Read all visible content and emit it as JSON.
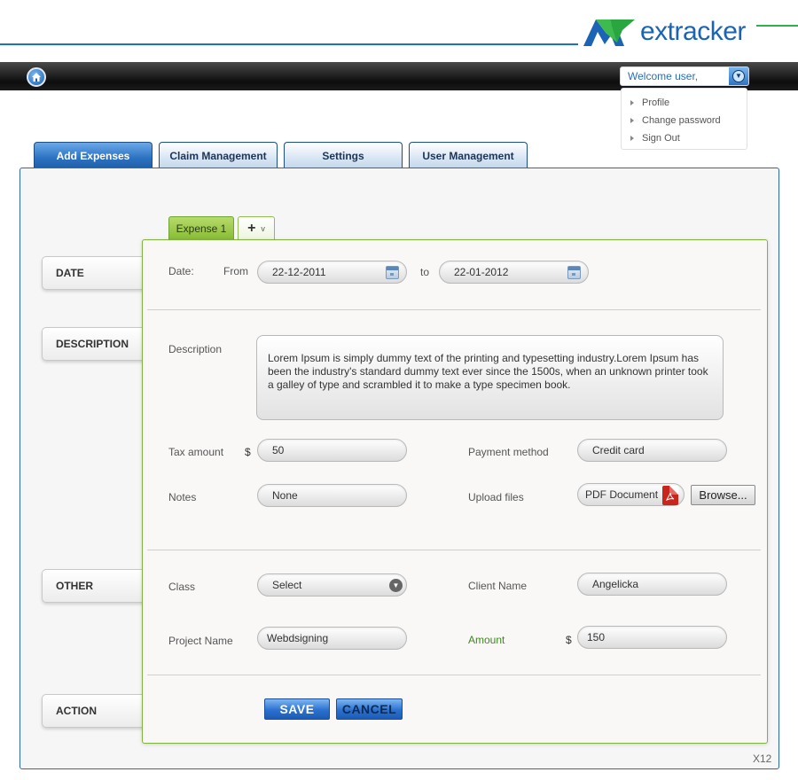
{
  "header": {
    "logo_text": "extracker",
    "welcome_label": "Welcome user,",
    "user_menu": [
      {
        "label": "Profile"
      },
      {
        "label": "Change password"
      },
      {
        "label": "Sign Out"
      }
    ]
  },
  "tabs": [
    {
      "label": "Add Expenses",
      "active": true
    },
    {
      "label": "Claim Management",
      "active": false
    },
    {
      "label": "Settings",
      "active": false
    },
    {
      "label": "User Management",
      "active": false
    }
  ],
  "sections": {
    "date": "DATE",
    "description": "DESCRIPTION",
    "other": "OTHER",
    "action": "ACTION"
  },
  "expense_tabs": {
    "current": "Expense 1",
    "add_symbol": "+",
    "add_caret": "v"
  },
  "form": {
    "date_label": "Date:",
    "from_label": "From",
    "from_value": "22-12-2011",
    "to_label": "to",
    "to_value": "22-01-2012",
    "description_label": "Description",
    "description_value": "Lorem Ipsum is simply dummy text of the printing and typesetting industry.Lorem Ipsum has been the industry's standard dummy text ever since the 1500s, when an unknown printer took a galley of type and scrambled it to make a type specimen book.",
    "tax_label": "Tax amount",
    "currency_symbol": "$",
    "tax_value": "50",
    "payment_label": "Payment method",
    "payment_value": "Credit card",
    "notes_label": "Notes",
    "notes_value": "None",
    "upload_label": "Upload files",
    "upload_value": "PDF Document",
    "browse_label": "Browse...",
    "class_label": "Class",
    "class_value": "Select",
    "client_label": "Client Name",
    "client_value": "Angelicka",
    "project_label": "Project Name",
    "project_value": "Webdsigning",
    "amount_label": "Amount",
    "amount_value": "150",
    "save_label": "SAVE",
    "cancel_label": "CANCEL"
  },
  "footer": {
    "page_code": "X12"
  },
  "colors": {
    "brand_blue": "#1b74c2",
    "brand_green": "#2db24a",
    "accent_green": "#86bb33",
    "amount_label_green": "#3b8a1c"
  },
  "icons": {
    "home": "home-icon",
    "user_menu_toggle": "chevron-down-icon",
    "calendar": "calendar-icon",
    "select_arrow": "chevron-down-icon",
    "pdf": "pdf-icon",
    "menu_bullet": "triangle-right-icon"
  }
}
